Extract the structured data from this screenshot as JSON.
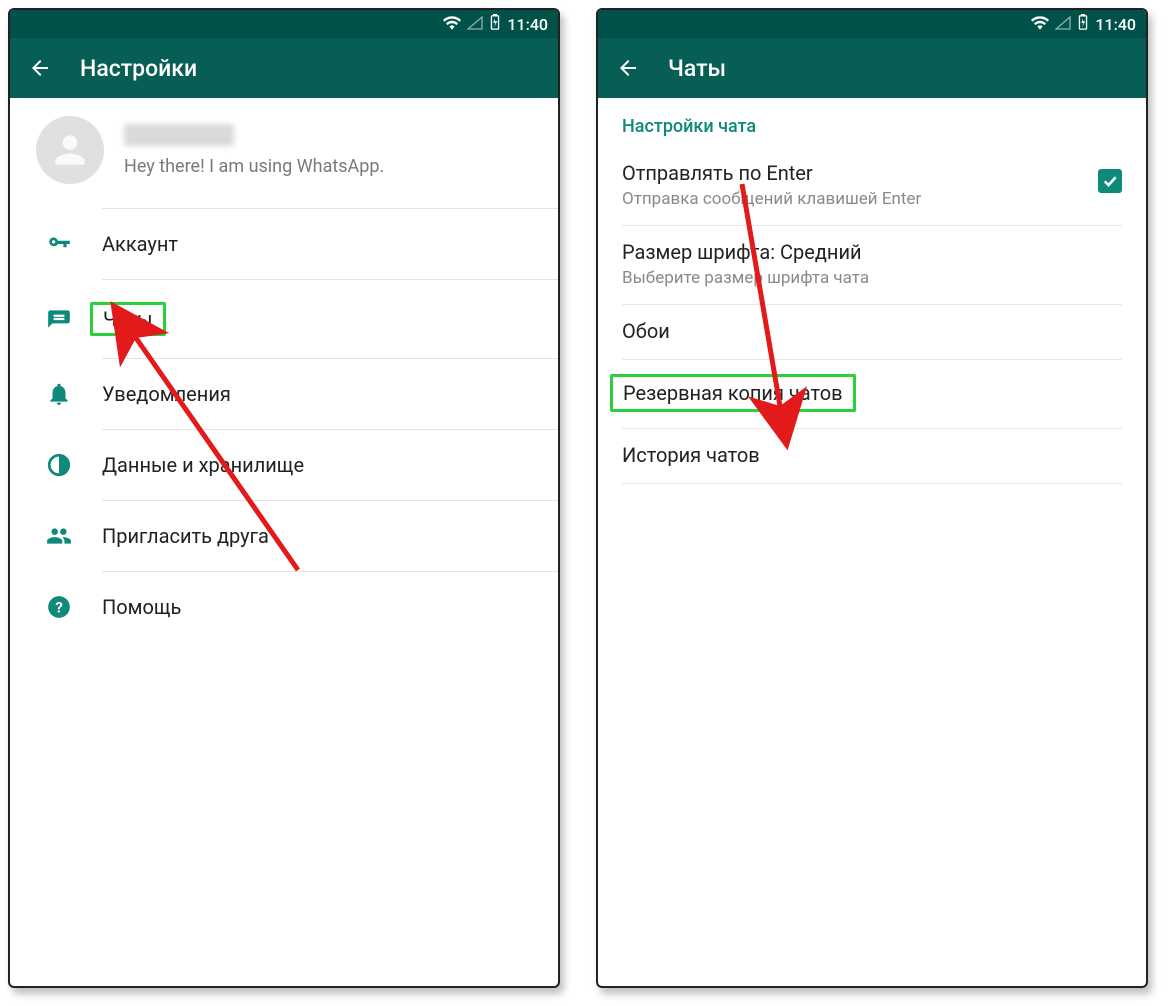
{
  "status": {
    "time": "11:40"
  },
  "left": {
    "appbar_title": "Настройки",
    "profile_status": "Hey there! I am using WhatsApp.",
    "menu": {
      "account": "Аккаунт",
      "chats": "Чаты",
      "notifications": "Уведомления",
      "data": "Данные и хранилище",
      "invite": "Пригласить друга",
      "help": "Помощь"
    }
  },
  "right": {
    "appbar_title": "Чаты",
    "section_header": "Настройки чата",
    "enter_send_title": "Отправлять по Enter",
    "enter_send_subtitle": "Отправка сообщений клавишей Enter",
    "enter_send_checked": true,
    "font_size_title": "Размер шрифта: Средний",
    "font_size_subtitle": "Выберите размер шрифта чата",
    "wallpaper": "Обои",
    "backup": "Резервная копия чатов",
    "history": "История чатов"
  }
}
